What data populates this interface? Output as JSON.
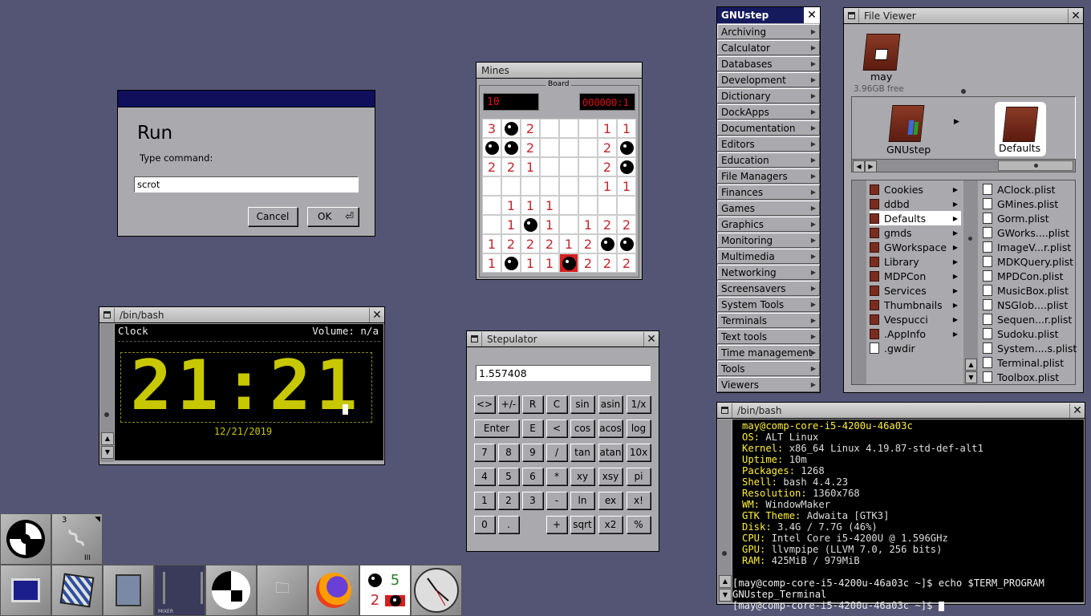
{
  "run_dialog": {
    "title": "Run",
    "prompt": "Type command:",
    "command_value": "scrot",
    "cancel_label": "Cancel",
    "ok_label": "OK"
  },
  "mines": {
    "title": "Mines",
    "board_label": "Board",
    "mine_counter": "10",
    "timer": "000000:1",
    "grid": [
      [
        "3",
        "B",
        "2",
        "",
        "",
        "",
        "1",
        "1"
      ],
      [
        "B",
        "B",
        "2",
        "",
        "",
        "",
        "2",
        "B"
      ],
      [
        "2",
        "2",
        "1",
        "",
        "",
        "",
        "2",
        "B"
      ],
      [
        "",
        "",
        "",
        "",
        "",
        "",
        "1",
        "1"
      ],
      [
        "",
        "1",
        "1",
        "1",
        "",
        "",
        "",
        ""
      ],
      [
        "",
        "1",
        "B",
        "1",
        "",
        "1",
        "2",
        "2"
      ],
      [
        "1",
        "2",
        "2",
        "2",
        "1",
        "2",
        "B",
        "B"
      ],
      [
        "1",
        "B",
        "1",
        "1",
        "X",
        "2",
        "2",
        "2"
      ]
    ]
  },
  "clock_term": {
    "title": "/bin/bash",
    "left_label": "Clock",
    "right_label": "Volume: n/a",
    "time": "21:21",
    "date": "12/21/2019"
  },
  "stepulator": {
    "title": "Stepulator",
    "display": "1.557408",
    "rows": [
      [
        "<>",
        "+/-",
        "R",
        "C",
        "sin",
        "asin",
        "1/x"
      ],
      [
        "Enter",
        "E",
        "<",
        "cos",
        "acos",
        "log"
      ],
      [
        "7",
        "8",
        "9",
        "/",
        "tan",
        "atan",
        "10x"
      ],
      [
        "4",
        "5",
        "6",
        "*",
        "xy",
        "xsy",
        "pi"
      ],
      [
        "1",
        "2",
        "3",
        "-",
        "ln",
        "ex",
        "x!"
      ],
      [
        "0",
        ".",
        "+",
        "sqrt",
        "x2",
        "%"
      ]
    ]
  },
  "gnustep_menu": {
    "title": "GNUstep",
    "items": [
      "Archiving",
      "Calculator",
      "Databases",
      "Development",
      "Dictionary",
      "DockApps",
      "Documentation",
      "Editors",
      "Education",
      "File Managers",
      "Finances",
      "Games",
      "Graphics",
      "Monitoring",
      "Multimedia",
      "Networking",
      "Screensavers",
      "System Tools",
      "Terminals",
      "Text tools",
      "Time management",
      "Tools",
      "Viewers"
    ]
  },
  "file_viewer": {
    "title": "File Viewer",
    "disk_name": "may",
    "disk_free": "3.96GB free",
    "path_items": [
      "GNUstep",
      "Defaults"
    ],
    "folders": [
      "Cookies",
      "ddbd",
      "Defaults",
      "gmds",
      "GWorkspace",
      "Library",
      "MDPCon",
      "Services",
      "Thumbnails",
      "Vespucci",
      ".AppInfo",
      ".gwdir"
    ],
    "files": [
      "AClock.plist",
      "GMines.plist",
      "Gorm.plist",
      "GWorks....plist",
      "ImageV...r.plist",
      "MDKQuery.plist",
      "MPDCon.plist",
      "MusicBox.plist",
      "NSGlob....plist",
      "Sequen...r.plist",
      "Sudoku.plist",
      "System....s.plist",
      "Terminal.plist",
      "Toolbox.plist"
    ]
  },
  "terminal": {
    "title": "/bin/bash",
    "header": "may@comp-core-i5-4200u-46a03c",
    "info": [
      {
        "k": "OS: ",
        "v": "ALT Linux"
      },
      {
        "k": "Kernel: ",
        "v": "x86_64 Linux 4.19.87-std-def-alt1"
      },
      {
        "k": "Uptime: ",
        "v": "10m"
      },
      {
        "k": "Packages: ",
        "v": "1268"
      },
      {
        "k": "Shell: ",
        "v": "bash 4.4.23"
      },
      {
        "k": "Resolution: ",
        "v": "1360x768"
      },
      {
        "k": "WM: ",
        "v": "WindowMaker"
      },
      {
        "k": "GTK Theme: ",
        "v": "Adwaita [GTK3]"
      },
      {
        "k": "Disk: ",
        "v": "3.4G / 7.7G (46%)"
      },
      {
        "k": "CPU: ",
        "v": "Intel Core i5-4200U @ 1.596GHz"
      },
      {
        "k": "GPU: ",
        "v": "llvmpipe (LLVM 7.0, 256 bits)"
      },
      {
        "k": "RAM: ",
        "v": "425MiB / 979MiB"
      }
    ],
    "prompt1": "[may@comp-core-i5-4200u-46a03c ~]$ echo $TERM_PROGRAM",
    "output": "GNUstep_Terminal",
    "prompt2": "[may@comp-core-i5-4200u-46a03c ~]$ "
  },
  "dock": {
    "workspace_number": "3",
    "workspace_label": "III",
    "mixer_label": "MIXER",
    "mines_digits": [
      "5",
      "2"
    ]
  }
}
